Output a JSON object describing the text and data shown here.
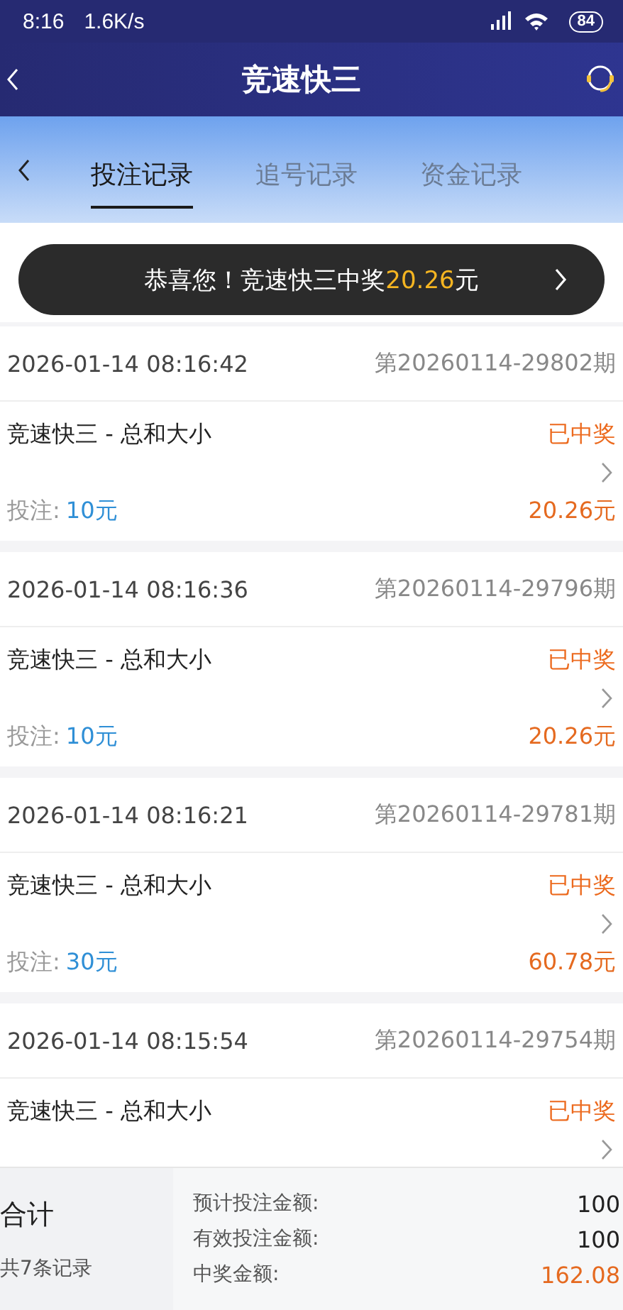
{
  "status_bar": {
    "time": "8:16",
    "speed": "1.6K/s",
    "battery": "84"
  },
  "header": {
    "title": "竞速快三"
  },
  "tabs": [
    {
      "label": "投注记录",
      "selected": true
    },
    {
      "label": "追号记录",
      "selected": false
    },
    {
      "label": "资金记录",
      "selected": false
    }
  ],
  "toast": {
    "text": "恭喜您！竞速快三中奖**20.26**元"
  },
  "records": [
    {
      "time": "2026-01-14 08:16:42",
      "period": "第20260114-29802期",
      "game": "竞速快三 - 总和大小",
      "status": "已中奖",
      "stake_label": "投注:",
      "stake": "10元",
      "prize": "20.26元"
    },
    {
      "time": "2026-01-14 08:16:36",
      "period": "第20260114-29796期",
      "game": "竞速快三 - 总和大小",
      "status": "已中奖",
      "stake_label": "投注:",
      "stake": "10元",
      "prize": "20.26元"
    },
    {
      "time": "2026-01-14 08:16:21",
      "period": "第20260114-29781期",
      "game": "竞速快三 - 总和大小",
      "status": "已中奖",
      "stake_label": "投注:",
      "stake": "30元",
      "prize": "60.78元"
    },
    {
      "time": "2026-01-14 08:15:54",
      "period": "第20260114-29754期",
      "game": "竞速快三 - 总和大小",
      "status": "已中奖"
    }
  ],
  "summary": {
    "title": "合计",
    "count": "共7条记录",
    "rows": [
      {
        "label": "预计投注金额:",
        "value": "100",
        "kind": "plain"
      },
      {
        "label": "有效投注金额:",
        "value": "100",
        "kind": "plain"
      },
      {
        "label": "中奖金额:",
        "value": "162.08",
        "kind": "prize"
      }
    ]
  }
}
